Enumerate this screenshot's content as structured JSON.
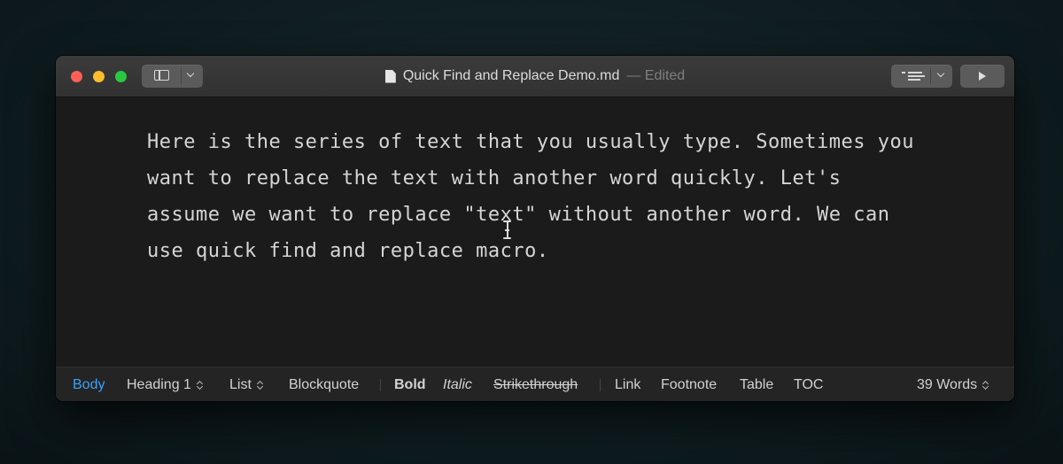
{
  "window": {
    "title": "Quick Find and Replace Demo.md",
    "status": "— Edited"
  },
  "editor": {
    "lines": [
      "Here is the series of text that you usually type. Sometimes you",
      "want to replace the text with another word quickly. Let's",
      "assume we want to replace \"text\" without another word. We can",
      "use quick find and replace macro."
    ]
  },
  "footer": {
    "body": "Body",
    "heading": "Heading 1",
    "list": "List",
    "blockquote": "Blockquote",
    "bold": "Bold",
    "italic": "Italic",
    "strikethrough": "Strikethrough",
    "link": "Link",
    "footnote": "Footnote",
    "table": "Table",
    "toc": "TOC",
    "word_count": "39 Words"
  },
  "colors": {
    "accent": "#3da1f5",
    "close": "#fe5f57",
    "minimize": "#febc2e",
    "maximize": "#28c840"
  },
  "icons": [
    "sidebar-icon",
    "chevron-down-icon",
    "document-icon",
    "outline-icon",
    "play-icon",
    "i-beam-cursor-icon",
    "updown-chevron-icon"
  ]
}
